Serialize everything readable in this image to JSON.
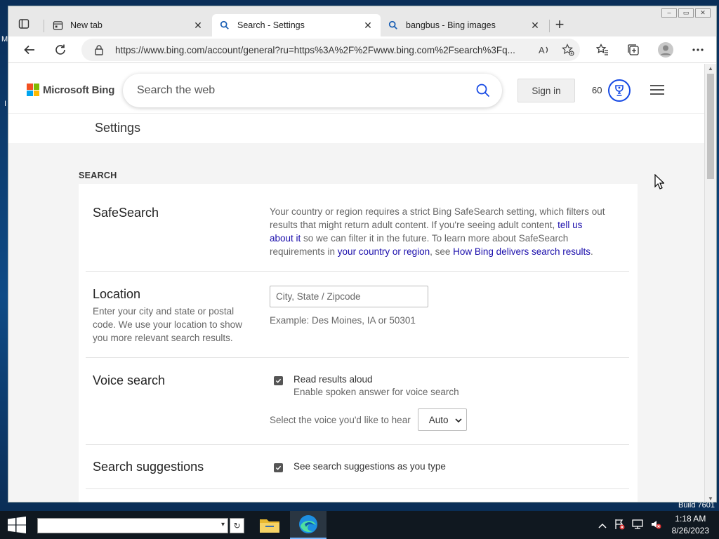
{
  "desktop": {
    "edge_label_1": "M",
    "edge_label_2": "I",
    "build": "Build 7601"
  },
  "tabs": [
    {
      "title": "New tab",
      "icon": "newtab-icon",
      "active": false
    },
    {
      "title": "Search - Settings",
      "icon": "bing-search-icon",
      "active": true
    },
    {
      "title": "bangbus - Bing images",
      "icon": "bing-search-icon",
      "active": false
    }
  ],
  "toolbar": {
    "url": "https://www.bing.com/account/general?ru=https%3A%2F%2Fwww.bing.com%2Fsearch%3Fq..."
  },
  "header": {
    "brand": "Microsoft Bing",
    "search_placeholder": "Search the web",
    "sign_in": "Sign in",
    "points": "60"
  },
  "settings_title": "Settings",
  "section": "SEARCH",
  "safesearch": {
    "heading": "SafeSearch",
    "text1": "Your country or region requires a strict Bing SafeSearch setting, which filters out results that might return adult content. If you're seeing adult content, ",
    "link1": "tell us about it",
    "text2": " so we can filter it in the future. To learn more about SafeSearch requirements in ",
    "link2": "your country or region",
    "text3": ", see ",
    "link3": "How Bing delivers search results",
    "text4": "."
  },
  "location": {
    "heading": "Location",
    "desc": "Enter your city and state or postal code. We use your location to show you more relevant search results.",
    "placeholder": "City, State / Zipcode",
    "example": "Example: Des Moines, IA or 50301"
  },
  "voice": {
    "heading": "Voice search",
    "checkbox_label": "Read results aloud",
    "checkbox_sub": "Enable spoken answer for voice search",
    "select_label": "Select the voice you'd like to hear",
    "select_value": "Auto"
  },
  "suggestions": {
    "heading": "Search suggestions",
    "checkbox_label": "See search suggestions as you type"
  },
  "taskbar": {
    "time": "1:18 AM",
    "date": "8/26/2023"
  },
  "colors": {
    "link": "#1a0dab",
    "reward_ring": "#174ae4",
    "ms_red": "#f25022",
    "ms_green": "#7fba00",
    "ms_blue": "#00a4ef",
    "ms_yellow": "#ffb900"
  }
}
